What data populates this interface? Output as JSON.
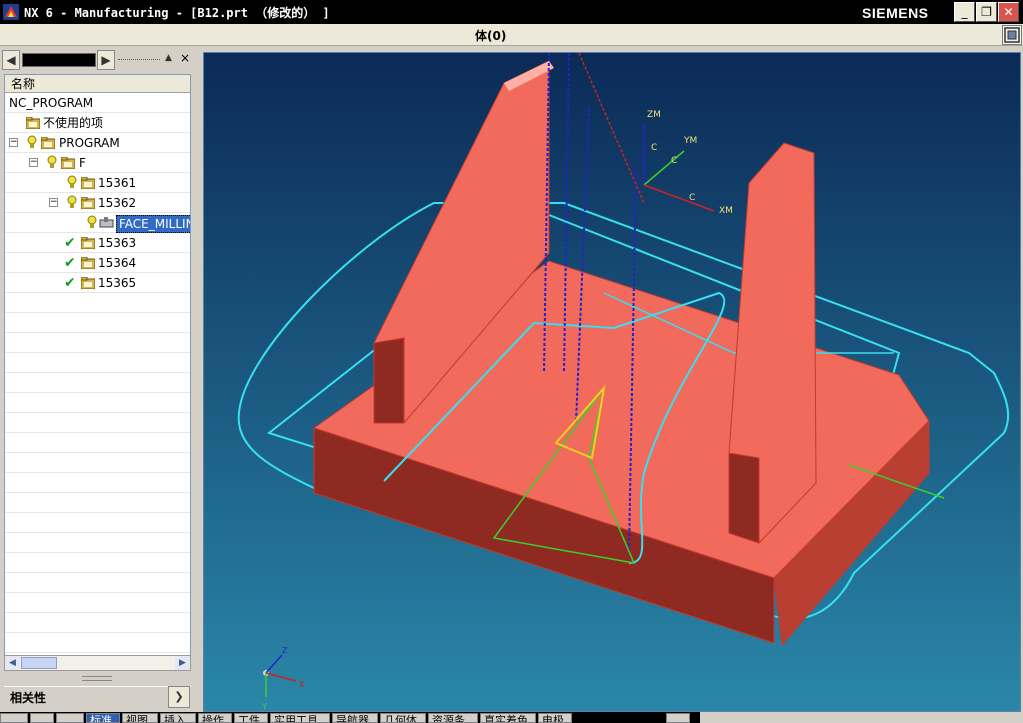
{
  "window": {
    "title": "NX 6 - Manufacturing - [B12.prt （修改的） ]",
    "brand": "SIEMENS",
    "minimize_glyph": "_",
    "maximize_glyph": "❐",
    "close_glyph": "✕"
  },
  "status": {
    "selection": "体(0)"
  },
  "navigator": {
    "left_arrow": "◀",
    "right_arrow": "▶",
    "pin_glyph": "▲",
    "close_glyph": "×",
    "column_header": "名称",
    "rows": [
      {
        "label": "NC_PROGRAM"
      },
      {
        "label": "不使用的项"
      },
      {
        "label": "PROGRAM",
        "expander": "−"
      },
      {
        "label": "F",
        "expander": "−"
      },
      {
        "label": "15361"
      },
      {
        "label": "15362",
        "expander": "−"
      },
      {
        "label": "FACE_MILLIN"
      },
      {
        "label": "15363"
      },
      {
        "label": "15364"
      },
      {
        "label": "15365"
      }
    ],
    "hscroll_left": "◀",
    "hscroll_right": "▶",
    "dependencies_header": "相关性",
    "dependencies_toggle": "❯"
  },
  "viewport": {
    "background_top": "#0b2a57",
    "background_bottom": "#2a87a8",
    "part_color": "#f26a5c",
    "toolpath_color": "#36e0f0",
    "axis_labels": {
      "zm": "ZM",
      "ym": "YM",
      "xm": "XM",
      "c1": "C",
      "c2": "C",
      "c3": "C"
    },
    "triad_labels": {
      "z": "Z",
      "x": "X",
      "y": "Y"
    }
  },
  "tabs": [
    {
      "label": "标准"
    },
    {
      "label": "视图"
    },
    {
      "label": "插入"
    },
    {
      "label": "操作"
    },
    {
      "label": "工件"
    },
    {
      "label": "实用工具"
    },
    {
      "label": "导航器"
    },
    {
      "label": "几何体"
    },
    {
      "label": "资源条"
    },
    {
      "label": "真实着色"
    },
    {
      "label": "电极"
    }
  ]
}
